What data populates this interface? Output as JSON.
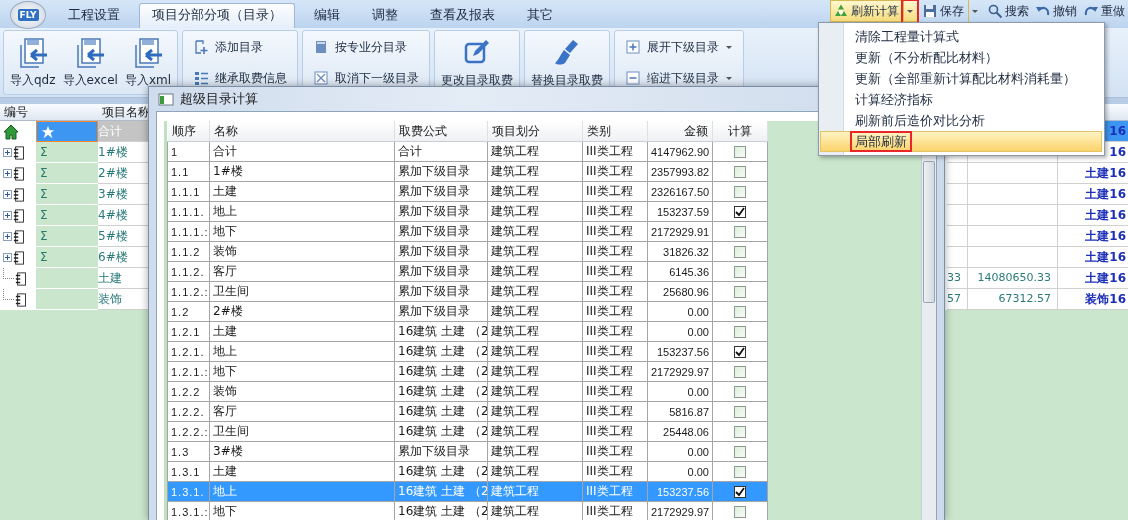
{
  "logo": {
    "text": "FLY"
  },
  "tabs": [
    {
      "label": "工程设置",
      "selected": false
    },
    {
      "label": "项目分部分项（目录）",
      "selected": true
    },
    {
      "label": "编辑",
      "selected": false
    },
    {
      "label": "调整",
      "selected": false
    },
    {
      "label": "查看及报表",
      "selected": false
    },
    {
      "label": "其它",
      "selected": false
    }
  ],
  "quick_toolbar": [
    {
      "kind": "refresh",
      "label": "刷新计算",
      "selected": true,
      "dropdown": true,
      "marked": true
    },
    {
      "kind": "save",
      "label": "保存",
      "selected": false,
      "dropdown": true,
      "marked": false
    },
    {
      "kind": "search",
      "label": "搜索",
      "selected": false,
      "dropdown": false,
      "marked": false
    },
    {
      "kind": "undo",
      "label": "撤销",
      "selected": false,
      "dropdown": false,
      "marked": false
    },
    {
      "kind": "redo",
      "label": "重做",
      "selected": false,
      "dropdown": false,
      "marked": false
    }
  ],
  "ribbon": {
    "groups": [
      {
        "items": [
          {
            "kind": "large",
            "label": "导入qdz"
          },
          {
            "kind": "large",
            "label": "导入excel"
          },
          {
            "kind": "large",
            "label": "导入xml"
          }
        ]
      },
      {
        "items": [
          {
            "kind": "small",
            "label": "添加目录"
          },
          {
            "kind": "small",
            "label": "继承取费信息"
          }
        ]
      },
      {
        "items": [
          {
            "kind": "small",
            "label": "按专业分目录"
          },
          {
            "kind": "small",
            "label": "取消下一级目录"
          }
        ]
      },
      {
        "items": [
          {
            "kind": "large",
            "label": "更改目录取费"
          }
        ]
      },
      {
        "items": [
          {
            "kind": "large",
            "label": "替换目录取费"
          }
        ]
      },
      {
        "items": [
          {
            "kind": "menu",
            "label": "展开下级目录"
          },
          {
            "kind": "menu",
            "label": "缩进下级目录"
          }
        ]
      }
    ]
  },
  "menu": {
    "items": [
      {
        "label": "清除工程量计算式",
        "selected": false,
        "marked": false
      },
      {
        "label": "更新（不分析配比材料）",
        "selected": false,
        "marked": false
      },
      {
        "label": "更新（全部重新计算配比材料消耗量）",
        "selected": false,
        "marked": false
      },
      {
        "label": "计算经济指标",
        "selected": false,
        "marked": false
      },
      {
        "label": "刷新前后造价对比分析",
        "selected": false,
        "marked": false
      },
      {
        "label": "局部刷新",
        "selected": true,
        "marked": true
      }
    ]
  },
  "tree": {
    "columns": [
      "编号",
      "项目名称"
    ],
    "rows": [
      {
        "kind": "total",
        "name": "合计",
        "selected": true
      },
      {
        "kind": "group",
        "code": "Σ",
        "name": "1#楼",
        "expanded": false,
        "selected": false
      },
      {
        "kind": "group",
        "code": "Σ",
        "name": "2#楼",
        "expanded": false,
        "selected": false
      },
      {
        "kind": "group",
        "code": "Σ",
        "name": "3#楼",
        "expanded": false,
        "selected": false
      },
      {
        "kind": "group",
        "code": "Σ",
        "name": "4#楼",
        "expanded": false,
        "selected": false
      },
      {
        "kind": "group",
        "code": "Σ",
        "name": "5#楼",
        "expanded": false,
        "selected": false
      },
      {
        "kind": "group",
        "code": "Σ",
        "name": "6#楼",
        "expanded": false,
        "selected": false
      },
      {
        "kind": "leaf",
        "name": "土建",
        "selected": false
      },
      {
        "kind": "leaf",
        "name": "装饰",
        "selected": false
      }
    ]
  },
  "right_grid": {
    "rows": [
      {
        "column_3": "16",
        "selected": true
      },
      {
        "column_3": "16",
        "selected": false
      },
      {
        "column_3": "土建16",
        "selected": false
      },
      {
        "column_3": "土建16",
        "selected": false
      },
      {
        "column_3": "土建16",
        "selected": false
      },
      {
        "column_3": "土建16",
        "selected": false
      },
      {
        "column_3": "土建16",
        "selected": false
      },
      {
        "column_1": "33",
        "column_2": "14080650.33",
        "column_3": "土建16",
        "selected": false
      },
      {
        "column_1": "57",
        "column_2": "67312.57",
        "column_3": "装饰16",
        "selected": false
      }
    ]
  },
  "dialog": {
    "title": "超级目录计算",
    "columns": [
      "顺序",
      "名称",
      "取费公式",
      "项目划分",
      "类别",
      "金额",
      "计算"
    ],
    "rows": [
      {
        "order": "1",
        "name": "合计",
        "formula": "合计",
        "division": "建筑工程",
        "category": "III类工程",
        "amount": "4147962.90",
        "calc": false,
        "selected": false
      },
      {
        "order": "1.1",
        "name": "1#楼",
        "formula": "累加下级目录",
        "division": "建筑工程",
        "category": "III类工程",
        "amount": "2357993.82",
        "calc": false,
        "selected": false
      },
      {
        "order": "1.1.1",
        "name": "土建",
        "formula": "累加下级目录",
        "division": "建筑工程",
        "category": "III类工程",
        "amount": "2326167.50",
        "calc": false,
        "selected": false
      },
      {
        "order": "1.1.1.",
        "name": "地上",
        "formula": "累加下级目录",
        "division": "建筑工程",
        "category": "III类工程",
        "amount": "153237.59",
        "calc": true,
        "selected": false
      },
      {
        "order": "1.1.1.:",
        "name": "地下",
        "formula": "累加下级目录",
        "division": "建筑工程",
        "category": "III类工程",
        "amount": "2172929.91",
        "calc": false,
        "selected": false
      },
      {
        "order": "1.1.2",
        "name": "装饰",
        "formula": "累加下级目录",
        "division": "建筑工程",
        "category": "III类工程",
        "amount": "31826.32",
        "calc": false,
        "selected": false
      },
      {
        "order": "1.1.2.",
        "name": "客厅",
        "formula": "累加下级目录",
        "division": "建筑工程",
        "category": "III类工程",
        "amount": "6145.36",
        "calc": false,
        "selected": false
      },
      {
        "order": "1.1.2.:",
        "name": "卫生间",
        "formula": "累加下级目录",
        "division": "建筑工程",
        "category": "III类工程",
        "amount": "25680.96",
        "calc": false,
        "selected": false
      },
      {
        "order": "1.2",
        "name": "2#楼",
        "formula": "累加下级目录",
        "division": "建筑工程",
        "category": "III类工程",
        "amount": "0.00",
        "calc": false,
        "selected": false
      },
      {
        "order": "1.2.1",
        "name": "土建",
        "formula": "16建筑 土建 （2",
        "division": "建筑工程",
        "category": "III类工程",
        "amount": "0.00",
        "calc": false,
        "selected": false
      },
      {
        "order": "1.2.1.",
        "name": "地上",
        "formula": "16建筑 土建 （2",
        "division": "建筑工程",
        "category": "III类工程",
        "amount": "153237.56",
        "calc": true,
        "selected": false
      },
      {
        "order": "1.2.1.:",
        "name": "地下",
        "formula": "16建筑 土建 （2",
        "division": "建筑工程",
        "category": "III类工程",
        "amount": "2172929.97",
        "calc": false,
        "selected": false
      },
      {
        "order": "1.2.2",
        "name": "装饰",
        "formula": "16建筑 土建 （2",
        "division": "建筑工程",
        "category": "III类工程",
        "amount": "0.00",
        "calc": false,
        "selected": false
      },
      {
        "order": "1.2.2.",
        "name": "客厅",
        "formula": "16建筑 土建 （2",
        "division": "建筑工程",
        "category": "III类工程",
        "amount": "5816.87",
        "calc": false,
        "selected": false
      },
      {
        "order": "1.2.2.:",
        "name": "卫生间",
        "formula": "16建筑 土建 （2",
        "division": "建筑工程",
        "category": "III类工程",
        "amount": "25448.06",
        "calc": false,
        "selected": false
      },
      {
        "order": "1.3",
        "name": "3#楼",
        "formula": "累加下级目录",
        "division": "建筑工程",
        "category": "III类工程",
        "amount": "0.00",
        "calc": false,
        "selected": false
      },
      {
        "order": "1.3.1",
        "name": "土建",
        "formula": "16建筑 土建 （2",
        "division": "建筑工程",
        "category": "III类工程",
        "amount": "0.00",
        "calc": false,
        "selected": false
      },
      {
        "order": "1.3.1.",
        "name": "地上",
        "formula": "16建筑 土建 （2",
        "division": "建筑工程",
        "category": "III类工程",
        "amount": "153237.56",
        "calc": true,
        "selected": true
      },
      {
        "order": "1.3.1.:",
        "name": "地下",
        "formula": "16建筑 土建 （2",
        "division": "建筑工程",
        "category": "III类工程",
        "amount": "2172929.97",
        "calc": false,
        "selected": false
      }
    ]
  }
}
